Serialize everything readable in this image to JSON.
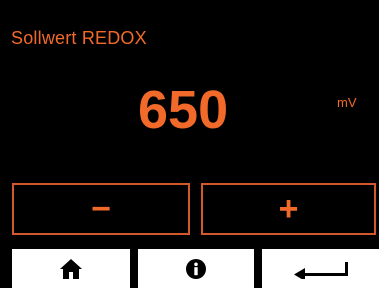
{
  "screen": {
    "title": "Sollwert REDOX",
    "value": "650",
    "unit": "mV"
  },
  "controls": {
    "decrease_label": "−",
    "increase_label": "+"
  },
  "nav": {
    "home_icon": "home-icon",
    "info_icon": "info-icon",
    "back_icon": "return-arrow-icon"
  },
  "colors": {
    "accent": "#f26a2a",
    "background": "#000000",
    "nav_background": "#ffffff"
  }
}
